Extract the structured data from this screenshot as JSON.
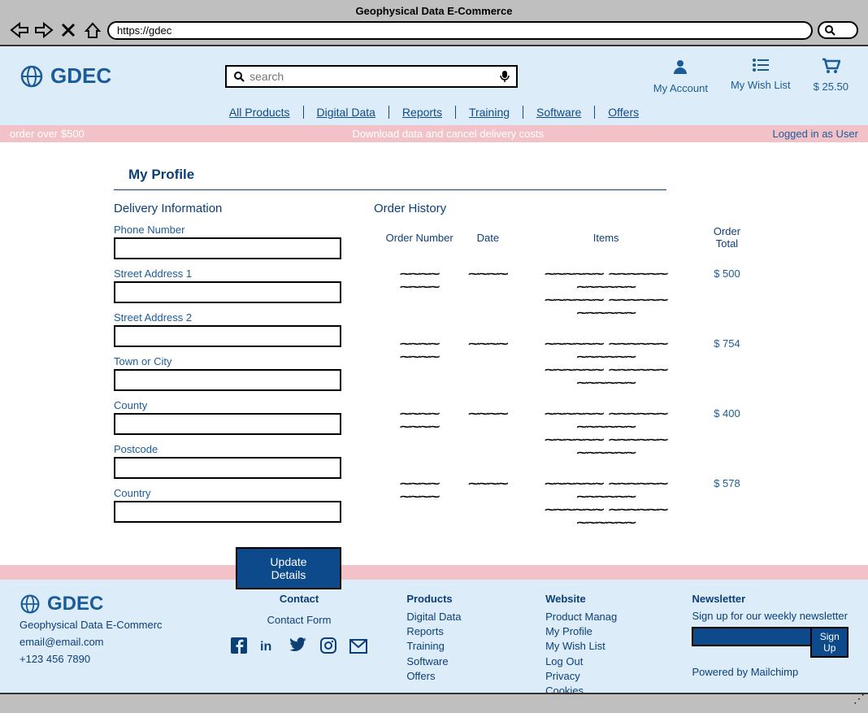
{
  "browser": {
    "window_title": "Geophysical Data E-Commerce",
    "url": "https://gdec"
  },
  "header": {
    "logo_text": "GDEC",
    "search_placeholder": "search",
    "actions": {
      "account_label": "My Account",
      "wishlist_label": "My Wish List",
      "cart_label": "$ 25.50"
    },
    "nav": [
      "All Products",
      "Digital Data",
      "Reports",
      "Training",
      "Software",
      "Offers"
    ]
  },
  "banner": {
    "left_text": "order over $500",
    "center_text": "Download data and cancel delivery costs",
    "right_text": "Logged in as User"
  },
  "profile": {
    "title": "My Profile",
    "delivery_heading": "Delivery Information",
    "fields": {
      "phone_label": "Phone Number",
      "street1_label": "Street Address 1",
      "street2_label": "Street Address 2",
      "town_label": "Town or City",
      "county_label": "County",
      "postcode_label": "Postcode",
      "country_label": "Country"
    },
    "update_btn": "Update Details"
  },
  "order_history": {
    "heading": "Order History",
    "columns": {
      "order_number": "Order Number",
      "date": "Date",
      "items": "Items",
      "total": "Order Total"
    },
    "rows": [
      {
        "total": "$ 500"
      },
      {
        "total": "$ 754"
      },
      {
        "total": "$ 400"
      },
      {
        "total": "$ 578"
      }
    ]
  },
  "footer": {
    "logo_text": "GDEC",
    "company_full": "Geophysical Data E-Commerc",
    "email": "email@email.com",
    "phone": "+123 456 7890",
    "contact_heading": "Contact",
    "contact_link": "Contact Form",
    "products_heading": "Products",
    "products_links": [
      "Digital Data",
      "Reports",
      "Training",
      "Software",
      "Offers"
    ],
    "website_heading": "Website",
    "website_links": [
      "Product Manag",
      "My Profile",
      "My Wish List",
      "Log Out",
      "Privacy",
      "Cookies"
    ],
    "newsletter_heading": "Newsletter",
    "newsletter_copy": "Sign up for our weekly newsletter",
    "signup_btn": "Sign Up",
    "powered_by": "Powered by Mailchimp"
  }
}
